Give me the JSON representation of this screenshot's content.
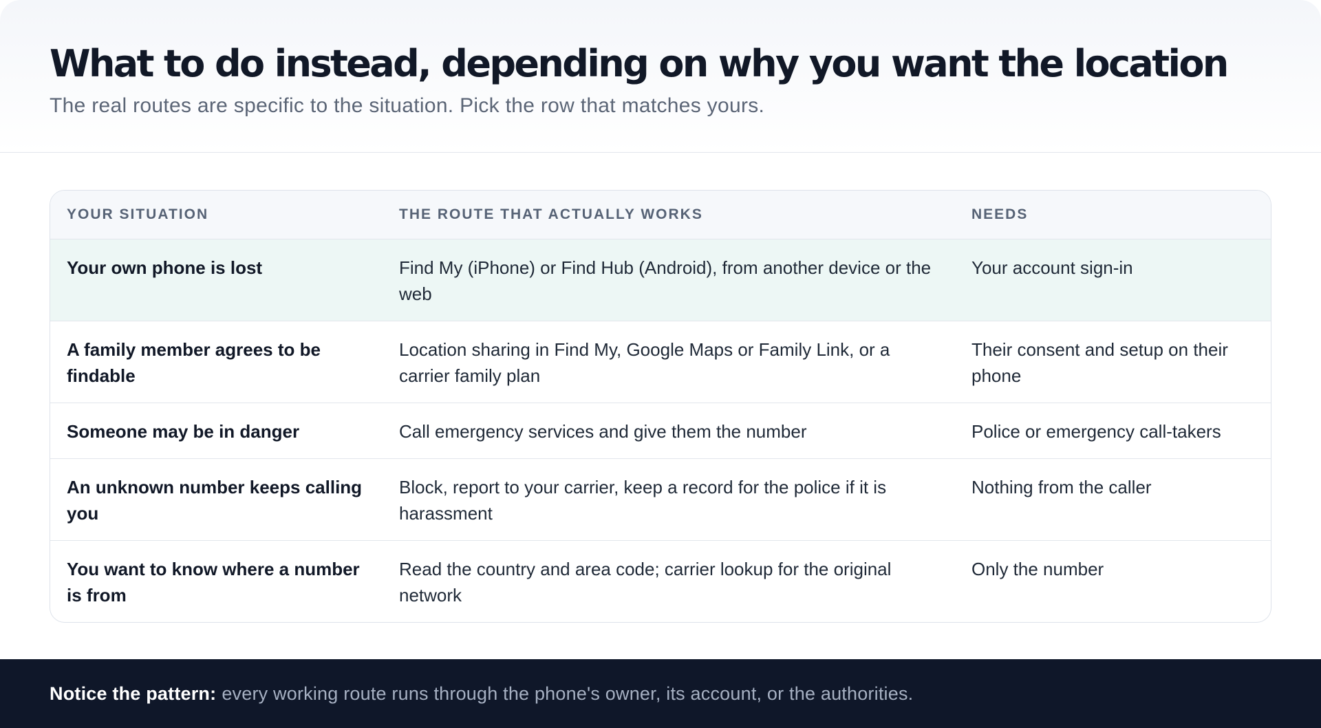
{
  "header": {
    "title": "What to do instead, depending on why you want the location",
    "subtitle": "The real routes are specific to the situation. Pick the row that matches yours."
  },
  "table": {
    "columns": [
      "YOUR SITUATION",
      "THE ROUTE THAT ACTUALLY WORKS",
      "NEEDS"
    ],
    "rows": [
      {
        "situation": "Your own phone is lost",
        "route": "Find My (iPhone) or Find Hub (Android), from another device or the web",
        "needs": "Your account sign-in"
      },
      {
        "situation": "A family member agrees to be findable",
        "route": "Location sharing in Find My, Google Maps or Family Link, or a carrier family plan",
        "needs": "Their consent and setup on their phone"
      },
      {
        "situation": "Someone may be in danger",
        "route": "Call emergency services and give them the number",
        "needs": "Police or emergency call-takers"
      },
      {
        "situation": "An unknown number keeps calling you",
        "route": "Block, report to your carrier, keep a record for the police if it is harassment",
        "needs": "Nothing from the caller"
      },
      {
        "situation": "You want to know where a number is from",
        "route": "Read the country and area code; carrier lookup for the original network",
        "needs": "Only the number"
      }
    ],
    "highlight_color": "#edf7f5"
  },
  "footer": {
    "lead": "Notice the pattern:",
    "text": "every working route runs through the phone's owner, its account, or the authorities."
  }
}
